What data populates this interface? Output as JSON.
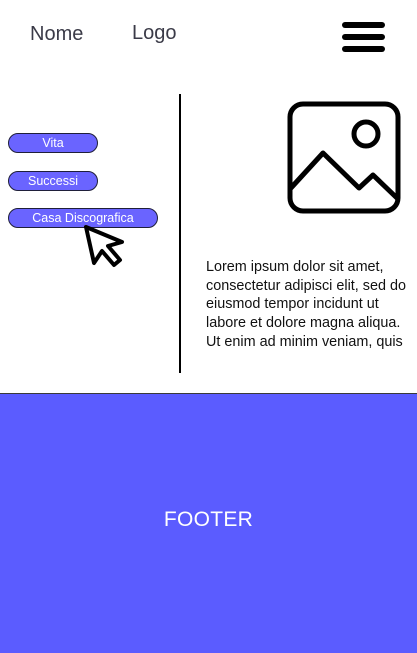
{
  "header": {
    "name_label": "Nome",
    "logo_label": "Logo",
    "menu_icon": "hamburger-menu-icon"
  },
  "nav": {
    "items": [
      {
        "label": "Vita"
      },
      {
        "label": "Successi"
      },
      {
        "label": "Casa Discografica"
      }
    ]
  },
  "content": {
    "image_icon": "image-placeholder-icon",
    "text": "Lorem ipsum dolor sit amet, consectetur adipisci elit, sed do eiusmod tempor incidunt ut labore et dolore magna aliqua. Ut enim ad minim veniam, quis"
  },
  "pointer": {
    "icon": "mouse-pointer-icon"
  },
  "footer": {
    "label": "FOOTER"
  },
  "colors": {
    "accent": "#6a64ff",
    "footer_bg": "#5b5cff",
    "text": "#3b3b48"
  }
}
